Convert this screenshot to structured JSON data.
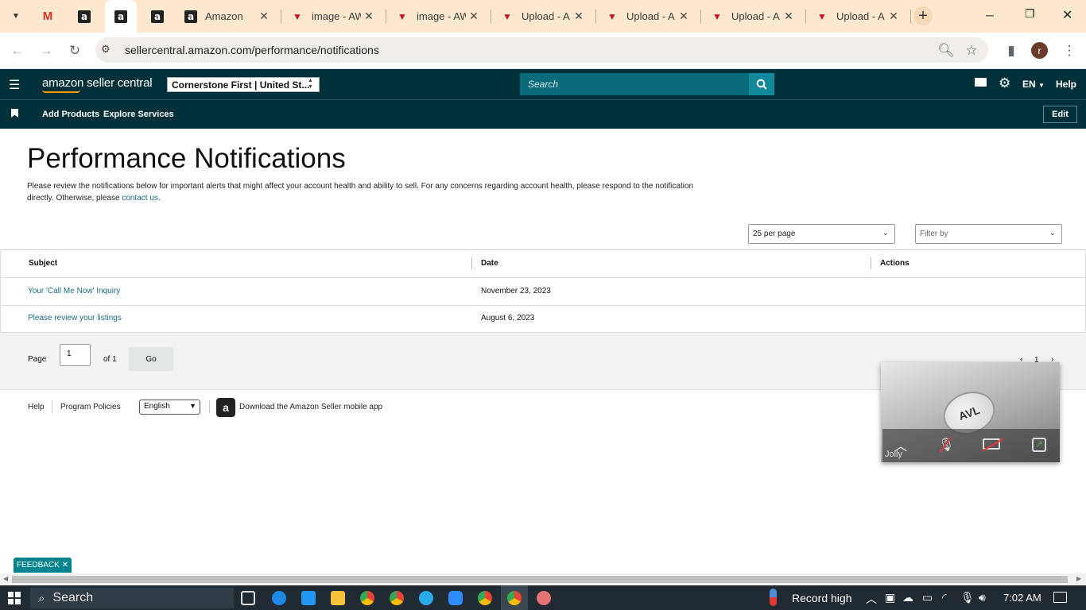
{
  "browser": {
    "tabs": [
      {
        "title": "",
        "icon": "gmail-icon"
      },
      {
        "title": "",
        "icon": "amazon-icon"
      },
      {
        "title": "",
        "icon": "amazon-icon"
      },
      {
        "title": "",
        "icon": "amazon-icon"
      },
      {
        "title": "Amazon",
        "icon": "amazon-icon"
      },
      {
        "title": "image - AW",
        "icon": "vendor-icon"
      },
      {
        "title": "image - AW",
        "icon": "vendor-icon"
      },
      {
        "title": "Upload - A",
        "icon": "vendor-icon"
      },
      {
        "title": "Upload - A",
        "icon": "vendor-icon"
      },
      {
        "title": "Upload - A",
        "icon": "vendor-icon"
      },
      {
        "title": "Upload - A",
        "icon": "vendor-icon"
      }
    ],
    "url": "sellercentral.amazon.com/performance/notifications",
    "profile_initial": "r"
  },
  "header": {
    "logo": "amazon seller central",
    "account": "Cornerstone First | United St...",
    "search_placeholder": "Search",
    "lang": "EN",
    "help": "Help",
    "nav": {
      "add_products": "Add Products",
      "explore_services": "Explore Services",
      "edit": "Edit"
    }
  },
  "main": {
    "title": "Performance Notifications",
    "intro": "Please review the notifications below for important alerts that might affect your account health and ability to sell. For any concerns regarding account health, please respond to the notification directly. Otherwise, please",
    "contact_link": "contact us",
    "intro_end": ".",
    "per_page": "25 per page",
    "filter_by": "Filter by",
    "columns": {
      "subject": "Subject",
      "date": "Date",
      "actions": "Actions"
    },
    "rows": [
      {
        "subject": "Your 'Call Me Now' Inquiry",
        "date": "November 23, 2023"
      },
      {
        "subject": "Please review your listings",
        "date": "August 6, 2023"
      }
    ],
    "pager": {
      "page_label": "Page",
      "page_value": "1",
      "of": "of 1",
      "go": "Go",
      "current": "1"
    }
  },
  "footer": {
    "help": "Help",
    "policies": "Program Policies",
    "language": "English",
    "app": "Download the Amazon Seller mobile app"
  },
  "video": {
    "name": "Jolly"
  },
  "feedback": "FEEDBACK",
  "taskbar": {
    "search": "Search",
    "weather": "Record high",
    "time": "7:02 AM"
  }
}
